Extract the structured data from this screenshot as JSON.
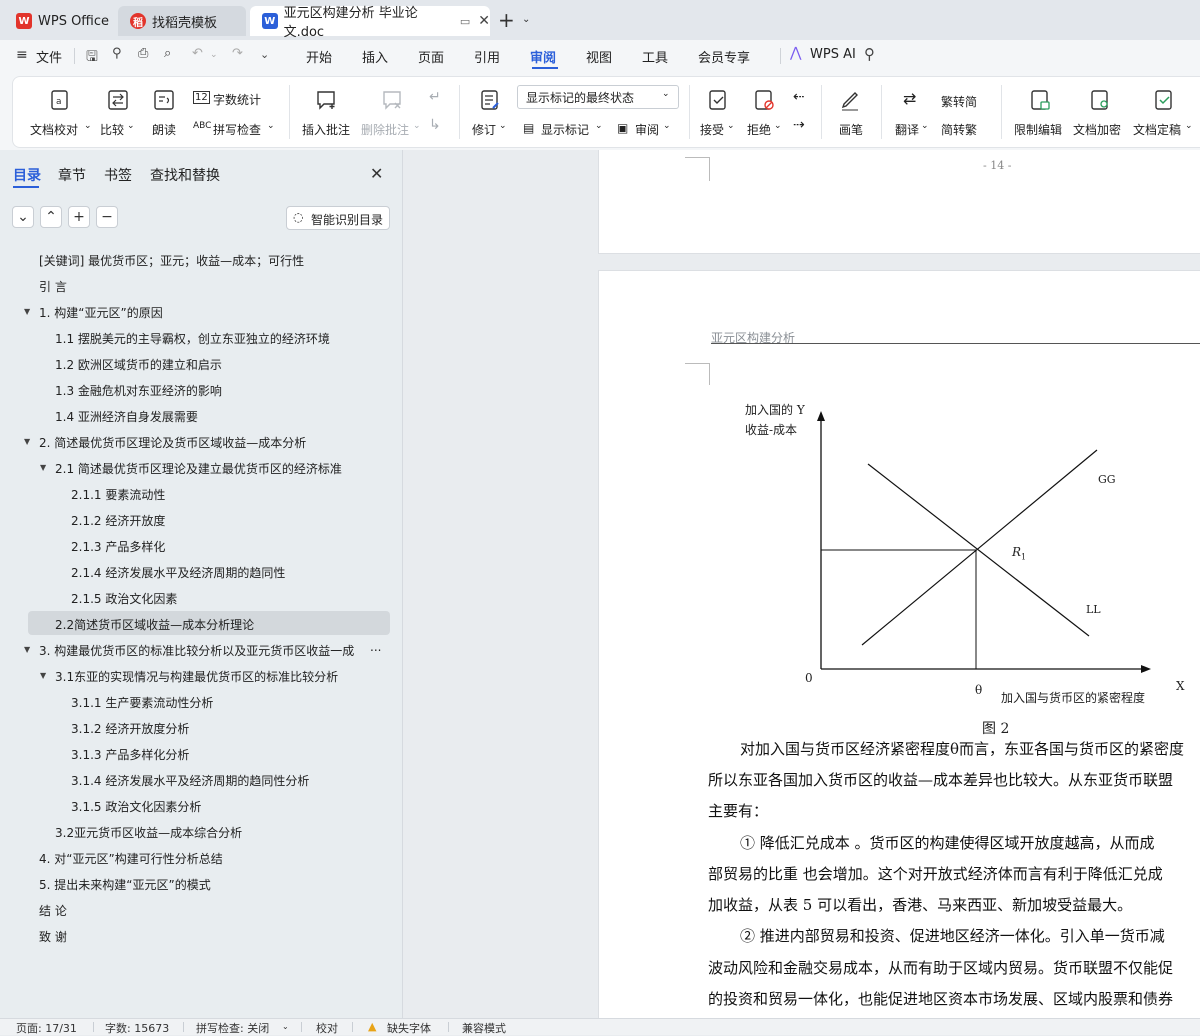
{
  "tabs": [
    {
      "label": "WPS Office",
      "icon": "wps-logo-icon"
    },
    {
      "label": "找稻壳模板",
      "icon": "docer-icon"
    },
    {
      "label": "亚元区构建分析 毕业论文.doc",
      "icon": "word-doc-icon"
    }
  ],
  "menubar": {
    "file": "文件",
    "items": [
      "开始",
      "插入",
      "页面",
      "引用",
      "审阅",
      "视图",
      "工具",
      "会员专享"
    ],
    "active": "审阅",
    "ai": "WPS AI"
  },
  "ribbon": {
    "doc_check": "文档校对",
    "compare": "比较",
    "read_aloud": "朗读",
    "word_count": "字数统计",
    "spell_check": "拼写检查",
    "insert_comment": "插入批注",
    "delete_comment": "删除批注",
    "revise": "修订",
    "display_mode": "显示标记的最终状态",
    "show_markup": "显示标记",
    "review": "审阅",
    "accept": "接受",
    "reject": "拒绝",
    "pen": "画笔",
    "translate": "翻译",
    "to_traditional": "繁转简",
    "to_simplified": "简转繁",
    "restrict_edit": "限制编辑",
    "encrypt": "文档加密",
    "finalize": "文档定稿"
  },
  "nav": {
    "tabs": [
      "目录",
      "章节",
      "书签",
      "查找和替换"
    ],
    "smart_toc": "智能识别目录",
    "items": [
      {
        "text": "[关键词]  最优货币区；亚元；收益—成本；可行性",
        "level": 0
      },
      {
        "text": "引    言",
        "level": 0
      },
      {
        "text": "1.  构建“亚元区”的原因",
        "level": 0,
        "expanded": true
      },
      {
        "text": "1.1    摆脱美元的主导霸权，创立东亚独立的经济环境",
        "level": 1
      },
      {
        "text": "1.2    欧洲区域货币的建立和启示",
        "level": 1
      },
      {
        "text": "1.3    金融危机对东亚经济的影响",
        "level": 1
      },
      {
        "text": "1.4    亚洲经济自身发展需要",
        "level": 1
      },
      {
        "text": "2.  简述最优货币区理论及货币区域收益—成本分析",
        "level": 0,
        "expanded": true
      },
      {
        "text": "2.1  简述最优货币区理论及建立最优货币区的经济标准",
        "level": 1,
        "expanded": true
      },
      {
        "text": "2.1.1    要素流动性",
        "level": 2
      },
      {
        "text": "2.1.2    经济开放度",
        "level": 2
      },
      {
        "text": "2.1.3    产品多样化",
        "level": 2
      },
      {
        "text": "2.1.4    经济发展水平及经济周期的趋同性",
        "level": 2
      },
      {
        "text": "2.1.5    政治文化因素",
        "level": 2
      },
      {
        "text": "2.2简述货币区域收益—成本分析理论",
        "level": 1,
        "selected": true
      },
      {
        "text": "3.  构建最优货币区的标准比较分析以及亚元货币区收益一成",
        "level": 0,
        "expanded": true,
        "more": "..."
      },
      {
        "text": "3.1东亚的实现情况与构建最优货币区的标准比较分析",
        "level": 1,
        "expanded": true
      },
      {
        "text": "3.1.1    生产要素流动性分析",
        "level": 2
      },
      {
        "text": "3.1.2    经济开放度分析",
        "level": 2
      },
      {
        "text": "3.1.3    产品多样化分析",
        "level": 2
      },
      {
        "text": "3.1.4    经济发展水平及经济周期的趋同性分析",
        "level": 2
      },
      {
        "text": "3.1.5    政治文化因素分析",
        "level": 2
      },
      {
        "text": "3.2亚元货币区收益—成本综合分析",
        "level": 1
      },
      {
        "text": "4.  对“亚元区”构建可行性分析总结",
        "level": 0
      },
      {
        "text": "5.  提出未来构建“亚元区”的模式",
        "level": 0
      },
      {
        "text": "结    论",
        "level": 0
      },
      {
        "text": "致    谢",
        "level": 0
      }
    ]
  },
  "document": {
    "page_number": "- 14 -",
    "header": "亚元区构建分析",
    "figure": {
      "y_label_1": "加入国的 Y",
      "y_label_2": "收益-成本",
      "gg": "GG",
      "ll": "LL",
      "r1": "R",
      "r1_sub": "1",
      "origin": "0",
      "theta": "θ",
      "x_label": "加入国与货币区的紧密程度",
      "x_axis": "X",
      "caption": "图 2"
    },
    "paragraphs": [
      "对加入国与货币区经济紧密程度θ而言，东亚各国与货币区的紧密度",
      "所以东亚各国加入货币区的收益—成本差异也比较大。从东亚货币联盟",
      "主要有：",
      "①    降低汇兑成本 。货币区的构建使得区域开放度越高，从而成",
      "部贸易的比重 也会增加。这个对开放式经济体而言有利于降低汇兑成",
      "加收益，从表 5 可以看出，香港、马来西亚、新加坡受益最大。",
      "②    推进内部贸易和投资、促进地区经济一体化。引入单一货币减",
      "波动风险和金融交易成本，从而有助于区域内贸易。货币联盟不仅能促",
      "的投资和贸易一体化，也能促进地区资本市场发展、区域内股票和债券"
    ]
  },
  "status": {
    "page": "页面: 17/31",
    "words": "字数: 15673",
    "spell": "拼写检查: 关闭",
    "proof": "校对",
    "missing_font": "缺失字体",
    "compat": "兼容模式"
  },
  "colors": {
    "accent": "#2b5fd9",
    "wps_red": "#e2342b",
    "selected_row": "#d3d8dc"
  }
}
